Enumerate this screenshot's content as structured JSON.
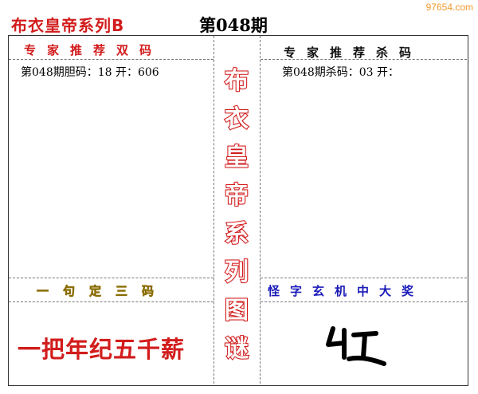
{
  "watermark": "97654.com",
  "title": "布衣皇帝系列B",
  "issue": "第048期",
  "left_header": "专家推荐双码",
  "left_line": "第048期胆码：18 开：606",
  "right_header": "专家推荐杀码",
  "right_line": "第048期杀码：03 开：",
  "center_chars": [
    "布",
    "衣",
    "皇",
    "帝",
    "系",
    "列",
    "图",
    "谜"
  ],
  "bottom_left_header": "一句定三码",
  "riddle": "一把年纪五千薪",
  "bottom_right_header": "怪字玄机中大奖",
  "colors": {
    "red": "#d21c1c",
    "yellow": "#e8c400",
    "blue": "#1a1ab8",
    "orange": "#f29a2e"
  }
}
